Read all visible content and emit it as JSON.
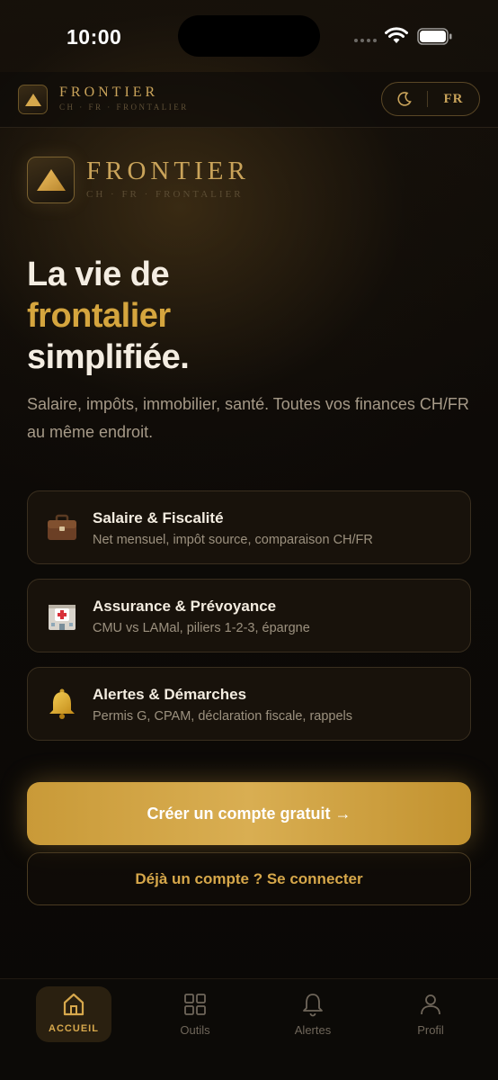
{
  "status_bar": {
    "time": "10:00"
  },
  "header": {
    "brand": "FRONTIER",
    "tagline": "CH · FR · FRONTALIER",
    "lang": "FR"
  },
  "hero": {
    "brand": "FRONTIER",
    "tagline": "CH · FR · FRONTALIER",
    "headline_1": "La vie de",
    "headline_2": "frontalier",
    "headline_3": "simplifiée.",
    "description": "Salaire, impôts, immobilier, santé. Toutes vos finances CH/FR au même endroit."
  },
  "features": [
    {
      "icon": "briefcase-icon",
      "title": "Salaire & Fiscalité",
      "subtitle": "Net mensuel, impôt source, comparaison CH/FR"
    },
    {
      "icon": "hospital-icon",
      "title": "Assurance & Prévoyance",
      "subtitle": "CMU vs LAMal, piliers 1-2-3, épargne"
    },
    {
      "icon": "bell-icon",
      "title": "Alertes & Démarches",
      "subtitle": "Permis G, CPAM, déclaration fiscale, rappels"
    }
  ],
  "actions": {
    "primary": "Créer un compte gratuit →",
    "secondary": "Déjà un compte ? Se connecter"
  },
  "tabs": [
    {
      "label": "ACCUEIL",
      "icon": "home-icon",
      "active": true
    },
    {
      "label": "Outils",
      "icon": "grid-icon",
      "active": false
    },
    {
      "label": "Alertes",
      "icon": "bell-icon",
      "active": false
    },
    {
      "label": "Profil",
      "icon": "user-icon",
      "active": false
    }
  ],
  "colors": {
    "accent": "#d5a53e",
    "background": "#0d0a07"
  }
}
